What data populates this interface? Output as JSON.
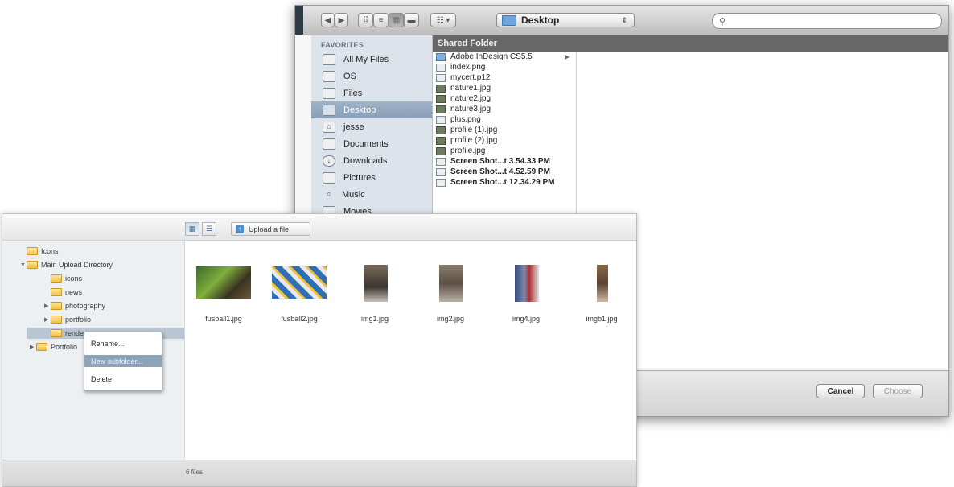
{
  "mac_dialog": {
    "location": "Desktop",
    "search": {
      "placeholder": ""
    },
    "sidebar": {
      "heading": "FAVORITES",
      "items": [
        {
          "label": "All My Files",
          "icon": "all-files-icon"
        },
        {
          "label": "OS",
          "icon": "drive-icon"
        },
        {
          "label": "Files",
          "icon": "drive-icon"
        },
        {
          "label": "Desktop",
          "icon": "desktop-icon",
          "selected": true
        },
        {
          "label": "jesse",
          "icon": "home-icon"
        },
        {
          "label": "Documents",
          "icon": "documents-icon"
        },
        {
          "label": "Downloads",
          "icon": "downloads-icon"
        },
        {
          "label": "Pictures",
          "icon": "pictures-icon"
        },
        {
          "label": "Music",
          "icon": "music-icon"
        },
        {
          "label": "Movies",
          "icon": "movies-icon"
        }
      ]
    },
    "column_title": "Shared Folder",
    "files": [
      {
        "name": "Adobe InDesign CS5.5",
        "kind": "folder"
      },
      {
        "name": "index.png",
        "kind": "file"
      },
      {
        "name": "mycert.p12",
        "kind": "file"
      },
      {
        "name": "nature1.jpg",
        "kind": "img"
      },
      {
        "name": "nature2.jpg",
        "kind": "img"
      },
      {
        "name": "nature3.jpg",
        "kind": "img"
      },
      {
        "name": "plus.png",
        "kind": "file"
      },
      {
        "name": "profile (1).jpg",
        "kind": "img"
      },
      {
        "name": "profile (2).jpg",
        "kind": "img"
      },
      {
        "name": "profile.jpg",
        "kind": "img"
      },
      {
        "name": "Screen Shot...t 3.54.33 PM",
        "kind": "file",
        "bold": true
      },
      {
        "name": "Screen Shot...t 4.52.59 PM",
        "kind": "file",
        "bold": true
      },
      {
        "name": "Screen Shot...t 12.34.29 PM",
        "kind": "file",
        "bold": true
      }
    ],
    "buttons": {
      "cancel": "Cancel",
      "choose": "Choose"
    }
  },
  "web_manager": {
    "upload_label": "Upload a file",
    "tree": [
      {
        "label": "Icons",
        "depth": 0,
        "toggle": ""
      },
      {
        "label": "Main Upload Directory",
        "depth": 0,
        "toggle": "▼"
      },
      {
        "label": "icons",
        "depth": 1,
        "toggle": ""
      },
      {
        "label": "news",
        "depth": 1,
        "toggle": ""
      },
      {
        "label": "photography",
        "depth": 1,
        "toggle": "▶"
      },
      {
        "label": "portfolio",
        "depth": 1,
        "toggle": "▶"
      },
      {
        "label": "renders",
        "depth": 1,
        "toggle": "",
        "selected": true
      },
      {
        "label": "Portfolio",
        "depth": 0,
        "toggle": "▶"
      }
    ],
    "context_menu": [
      "Rename...",
      "New subfolder...",
      "Delete"
    ],
    "thumbnails": [
      {
        "name": "fusball1.jpg"
      },
      {
        "name": "fusball2.jpg"
      },
      {
        "name": "img1.jpg"
      },
      {
        "name": "img2.jpg"
      },
      {
        "name": "img4.jpg"
      },
      {
        "name": "imgb1.jpg"
      }
    ],
    "status": "6 files"
  }
}
